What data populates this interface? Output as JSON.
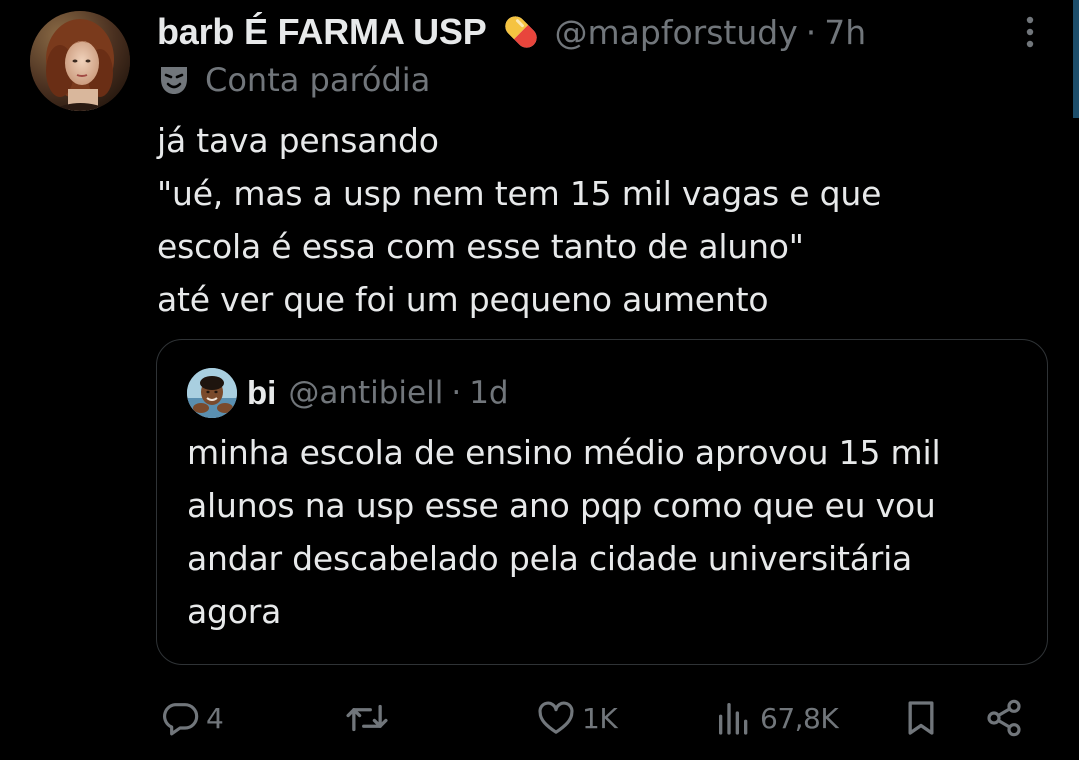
{
  "author": {
    "display_name": "barb É FARMA USP",
    "handle": "@mapforstudy",
    "separator": "·",
    "time": "7h",
    "badge_icon": "pill-emoji-icon",
    "label_icon": "theater-mask-icon",
    "label": "Conta paródia"
  },
  "tweet": {
    "lines": [
      "já tava pensando",
      "\"ué, mas a usp nem tem 15 mil vagas e que",
      "escola é essa com esse tanto de aluno\"",
      "até ver que foi um pequeno aumento"
    ]
  },
  "quoted": {
    "display_name": "bi",
    "handle": "@antibiell",
    "separator": "·",
    "time": "1d",
    "lines": [
      "minha escola de ensino médio aprovou 15 mil",
      "alunos na usp esse ano pqp como que eu vou",
      "andar descabelado pela cidade universitária",
      "agora"
    ]
  },
  "actions": {
    "reply": {
      "icon": "reply-icon",
      "count": "4"
    },
    "retweet": {
      "icon": "retweet-icon"
    },
    "like": {
      "icon": "heart-icon",
      "count": "1K"
    },
    "views": {
      "icon": "views-chart-icon",
      "count": "67,8K"
    },
    "bookmark": {
      "icon": "bookmark-icon"
    },
    "share": {
      "icon": "share-icon"
    }
  },
  "colors": {
    "background": "#000000",
    "text_primary": "#e7e9ea",
    "text_secondary": "#71767b",
    "border": "#2f3336"
  }
}
